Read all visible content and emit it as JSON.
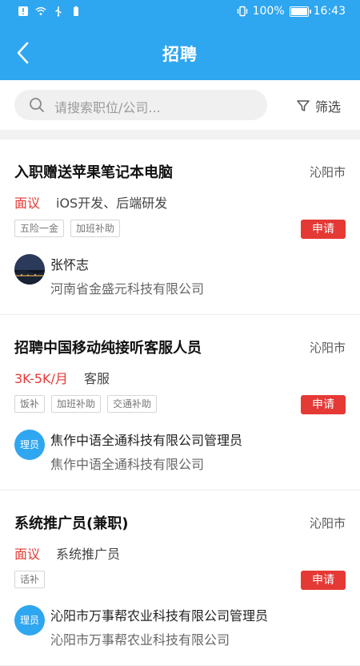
{
  "status_bar": {
    "battery_percent": "100%",
    "time": "16:43",
    "battery_level": 1.0
  },
  "header": {
    "title": "招聘"
  },
  "search": {
    "placeholder": "请搜索职位/公司...",
    "filter_label": "筛选"
  },
  "colors": {
    "primary": "#2fa6f0",
    "accent_red": "#e53935"
  },
  "jobs": [
    {
      "title": "入职赠送苹果笔记本电脑",
      "city": "沁阳市",
      "salary": "面议",
      "category": "iOS开发、后端研发",
      "tags": [
        "五险一金",
        "加班补助"
      ],
      "apply_label": "申请",
      "poster_name": "张怀志",
      "company": "河南省金盛元科技有限公司",
      "avatar_type": "photo"
    },
    {
      "title": "招聘中国移动纯接听客服人员",
      "city": "沁阳市",
      "salary": "3K-5K/月",
      "category": "客服",
      "tags": [
        "饭补",
        "加班补助",
        "交通补助"
      ],
      "apply_label": "申请",
      "poster_name": "焦作中语全通科技有限公司管理员",
      "company": "焦作中语全通科技有限公司",
      "avatar_type": "badge",
      "avatar_text": "理员"
    },
    {
      "title": "系统推广员(兼职)",
      "city": "沁阳市",
      "salary": "面议",
      "category": "系统推广员",
      "tags": [
        "话补"
      ],
      "apply_label": "申请",
      "poster_name": "沁阳市万事帮农业科技有限公司管理员",
      "company": "沁阳市万事帮农业科技有限公司",
      "avatar_type": "badge",
      "avatar_text": "理员"
    }
  ]
}
